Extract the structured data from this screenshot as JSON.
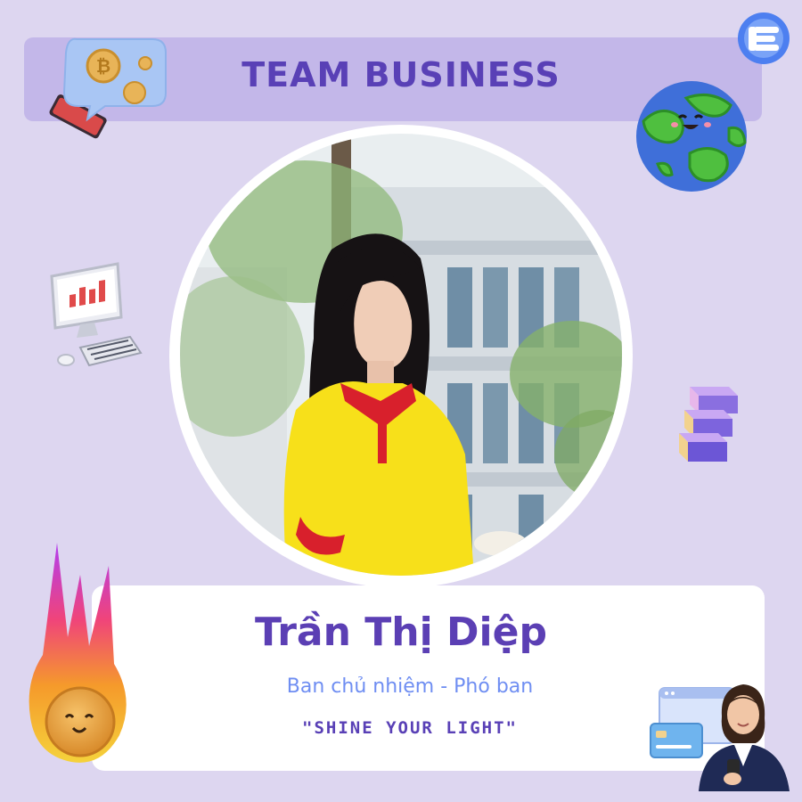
{
  "header": {
    "title": "TEAM BUSINESS"
  },
  "profile": {
    "name": "Trần Thị Diệp",
    "role": "Ban chủ nhiệm - Phó ban",
    "quote": "\"SHINE YOUR LIGHT\""
  },
  "colors": {
    "background": "#ddd6f0",
    "header_band": "#c3b7e9",
    "title": "#5940b6",
    "role_text": "#6f8ef2",
    "card": "#ffffff",
    "logo_blue": "#4d7ff0"
  },
  "icons": [
    "brand-logo-icon",
    "crypto-chat-bubble-icon",
    "smiling-earth-icon",
    "computer-chart-icon",
    "stacked-cubes-icon",
    "fireball-icon",
    "businesswoman-cards-icon"
  ]
}
